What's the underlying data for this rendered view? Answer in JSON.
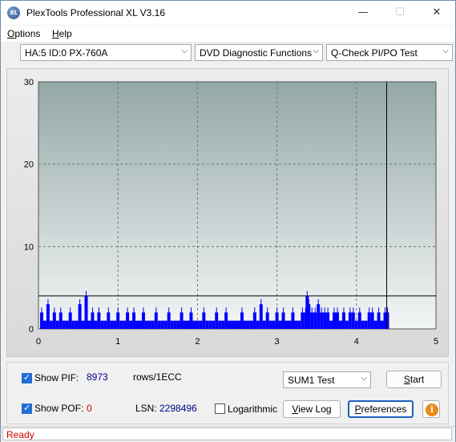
{
  "window": {
    "title": "PlexTools Professional XL V3.16",
    "icon_text": "XL",
    "min_glyph": "—",
    "max_glyph": "☐",
    "close_glyph": "✕"
  },
  "menu": {
    "options": "Options",
    "help": "Help"
  },
  "toolbar": {
    "drive": "HA:5 ID:0  PX-760A",
    "function": "DVD Diagnostic Functions",
    "test": "Q-Check PI/PO Test"
  },
  "chart_data": {
    "type": "bar",
    "x_ticks": [
      "0",
      "1",
      "2",
      "3",
      "4",
      "5"
    ],
    "y_ticks": [
      "0",
      "10",
      "20",
      "30"
    ],
    "xlim": [
      0,
      5
    ],
    "ylim": [
      0,
      30
    ],
    "grid": true,
    "threshold_line": 4,
    "end_marker_x": 4.38,
    "series": [
      {
        "color": "#0000ff",
        "x": [
          0.02,
          0.06,
          0.1,
          0.14,
          0.18,
          0.22,
          0.26,
          0.3,
          0.34,
          0.38,
          0.42,
          0.46,
          0.5,
          0.54,
          0.58,
          0.62,
          0.66,
          0.7,
          0.74,
          0.78,
          0.82,
          0.86,
          0.9,
          0.94,
          0.98,
          1.02,
          1.06,
          1.1,
          1.14,
          1.18,
          1.22,
          1.26,
          1.3,
          1.34,
          1.38,
          1.42,
          1.46,
          1.5,
          1.54,
          1.58,
          1.62,
          1.66,
          1.7,
          1.74,
          1.78,
          1.82,
          1.86,
          1.9,
          1.94,
          1.98,
          2.02,
          2.06,
          2.1,
          2.14,
          2.18,
          2.22,
          2.26,
          2.3,
          2.34,
          2.38,
          2.42,
          2.46,
          2.5,
          2.54,
          2.58,
          2.62,
          2.66,
          2.7,
          2.74,
          2.78,
          2.82,
          2.86,
          2.9,
          2.94,
          2.98,
          3.02,
          3.06,
          3.1,
          3.14,
          3.18,
          3.22,
          3.26,
          3.3,
          3.34,
          3.36,
          3.38,
          3.42,
          3.46,
          3.5,
          3.54,
          3.58,
          3.62,
          3.66,
          3.7,
          3.74,
          3.78,
          3.82,
          3.86,
          3.9,
          3.94,
          3.98,
          4.02,
          4.06,
          4.1,
          4.14,
          4.18,
          4.22,
          4.26,
          4.3,
          4.34,
          4.37
        ],
        "values": [
          2,
          1,
          3,
          1,
          2,
          1,
          2,
          1,
          1,
          2,
          1,
          1,
          3,
          1,
          4,
          1,
          2,
          1,
          2,
          1,
          1,
          2,
          1,
          1,
          2,
          1,
          1,
          2,
          1,
          2,
          1,
          1,
          2,
          1,
          1,
          1,
          2,
          1,
          1,
          1,
          2,
          1,
          1,
          1,
          2,
          1,
          1,
          2,
          1,
          1,
          1,
          2,
          1,
          1,
          1,
          2,
          1,
          1,
          2,
          1,
          1,
          1,
          1,
          2,
          1,
          1,
          1,
          2,
          1,
          3,
          1,
          2,
          1,
          1,
          2,
          1,
          2,
          1,
          1,
          2,
          1,
          1,
          2,
          2,
          4,
          3,
          2,
          2,
          3,
          2,
          2,
          2,
          1,
          2,
          2,
          1,
          2,
          1,
          2,
          2,
          1,
          2,
          1,
          1,
          2,
          2,
          1,
          2,
          1,
          2,
          2
        ]
      }
    ]
  },
  "controls": {
    "show_pif_label": "Show PIF:",
    "pif_value": "8973",
    "pif_unit": "rows/1ECC",
    "show_pof_label": "Show POF:",
    "pof_value": "0",
    "lsn_label": "LSN:",
    "lsn_value": "2298496",
    "logarithmic_label": "Logarithmic",
    "sum_select": "SUM1 Test",
    "start_button": "Start",
    "view_log_button": "View Log",
    "preferences_button": "Preferences",
    "info_glyph": "i"
  },
  "status": {
    "text": "Ready"
  }
}
